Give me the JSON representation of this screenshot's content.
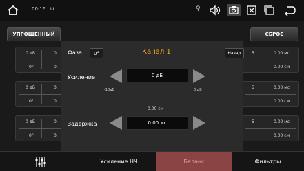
{
  "status": {
    "time": "00:16",
    "usb_glyph": "ψ",
    "icons": [
      "home-icon",
      "location-icon",
      "volume-icon",
      "screenshot-icon",
      "close-window-icon",
      "window-icon",
      "back-icon"
    ]
  },
  "toolbar": {
    "simple_label": "УПРОЩЕННЫЙ",
    "reset_label": "СБРОС"
  },
  "left_blocks": [
    {
      "gain": "0 дБ",
      "gain2": "0.",
      "phase": "0°",
      "phase2": "0."
    },
    {
      "gain": "0 дБ",
      "gain2": "0.",
      "phase": "0°",
      "phase2": "0."
    },
    {
      "gain": "0 дБ",
      "gain2": "0.",
      "phase": "0°",
      "phase2": "0."
    }
  ],
  "right_blocks": [
    {
      "cut": "5",
      "delay_ms": "0.00 мс",
      "delay_cm": "0.00 см"
    },
    {
      "cut": "5",
      "delay_ms": "0.00 мс",
      "delay_cm": "0.00 см"
    },
    {
      "cut": "5",
      "delay_ms": "0.00 мс",
      "delay_cm": "0.00 см"
    }
  ],
  "modal": {
    "phase_label": "Фаза",
    "phase_value": "0°",
    "channel_title": "Канал 1",
    "back_label": "Назад",
    "gain_label": "Усиление",
    "gain_value": "0 дБ",
    "gain_min": "-10дБ",
    "gain_max": "0 дБ",
    "distance_value": "0.00 см",
    "delay_label": "Задержка",
    "delay_value": "0.00 мс"
  },
  "tabs": [
    {
      "label": ""
    },
    {
      "label": "Усиление НЧ"
    },
    {
      "label": "Баланс"
    },
    {
      "label": "Фильтры"
    }
  ],
  "colors": {
    "accent": "#f7a51b",
    "active_tab": "#8a4444"
  }
}
